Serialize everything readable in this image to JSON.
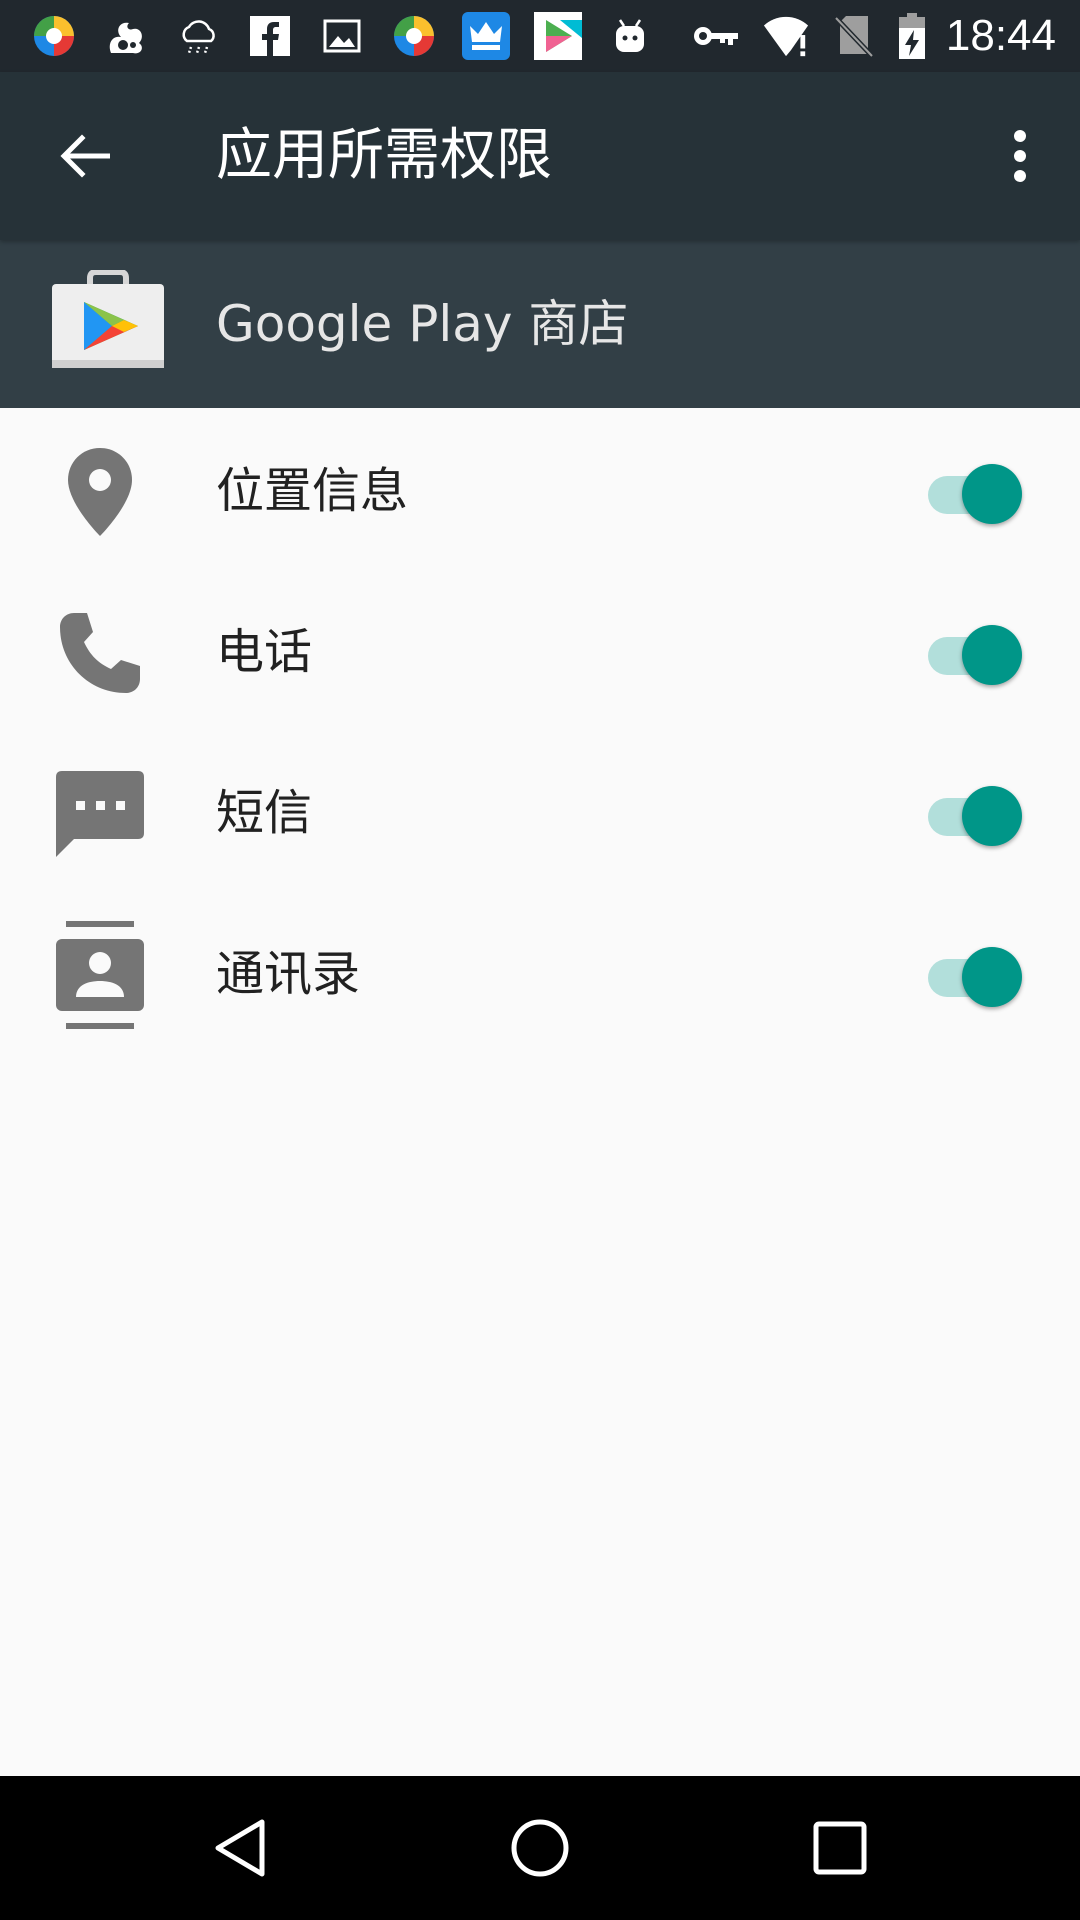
{
  "status_bar": {
    "time": "18:44",
    "notification_icons": [
      "app-icon",
      "uc-browser-icon",
      "weather-icon",
      "facebook-icon",
      "gallery-icon",
      "app-icon",
      "kingroot-icon",
      "play-store-icon",
      "android-icon"
    ],
    "system_icons": [
      "vpn-key-icon",
      "wifi-alert-icon",
      "no-sim-icon",
      "battery-charging-icon"
    ]
  },
  "app_bar": {
    "title": "应用所需权限"
  },
  "app_header": {
    "app_name": "Google Play 商店"
  },
  "permissions": [
    {
      "label": "位置信息",
      "icon": "location-icon",
      "enabled": true
    },
    {
      "label": "电话",
      "icon": "phone-icon",
      "enabled": true
    },
    {
      "label": "短信",
      "icon": "sms-icon",
      "enabled": true
    },
    {
      "label": "通讯录",
      "icon": "contacts-icon",
      "enabled": true
    }
  ],
  "colors": {
    "status_bar": "#21282e",
    "app_bar": "#263238",
    "app_header": "#323f46",
    "accent": "#009688",
    "switch_track": "#b2dfdb",
    "icon_gray": "#757575"
  }
}
